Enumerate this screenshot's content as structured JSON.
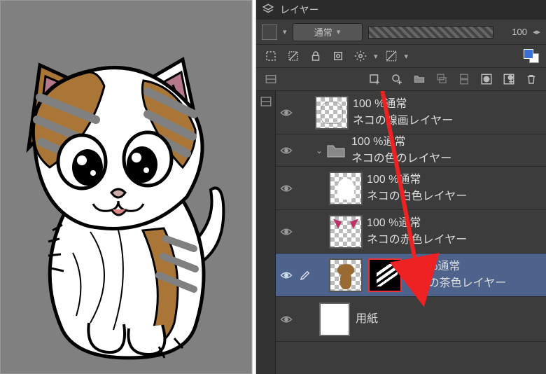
{
  "panel": {
    "title": "レイヤー",
    "blend_mode": "通常",
    "opacity_display": "100",
    "opacity_arrows": "◀ ▶"
  },
  "layers": [
    {
      "id": "lineart",
      "blend": "100 %通常",
      "name": "ネコの線画レイヤー",
      "visible": true,
      "selected": false,
      "indent": 0,
      "thumb": "lines"
    },
    {
      "id": "colorfolder",
      "blend": "100 %通常",
      "name": "ネコの色のレイヤー",
      "visible": true,
      "selected": false,
      "type": "folder",
      "expanded": true,
      "indent": 0
    },
    {
      "id": "white",
      "blend": "100 %通常",
      "name": "ネコの白色レイヤー",
      "visible": true,
      "selected": false,
      "indent": 1,
      "thumb": "white"
    },
    {
      "id": "red",
      "blend": "100 %通常",
      "name": "ネコの赤色レイヤー",
      "visible": true,
      "selected": false,
      "indent": 1,
      "thumb": "red"
    },
    {
      "id": "brown",
      "blend": "100 %通常",
      "name": "ネコの茶色レイヤー",
      "visible": true,
      "selected": true,
      "indent": 1,
      "thumb": "brown",
      "has_mask": true
    },
    {
      "id": "paper",
      "blend": "",
      "name": "用紙",
      "visible": true,
      "selected": false,
      "type": "paper",
      "indent": 0
    }
  ],
  "icons": {
    "layers": "layers-icon",
    "eye": "eye-icon"
  }
}
